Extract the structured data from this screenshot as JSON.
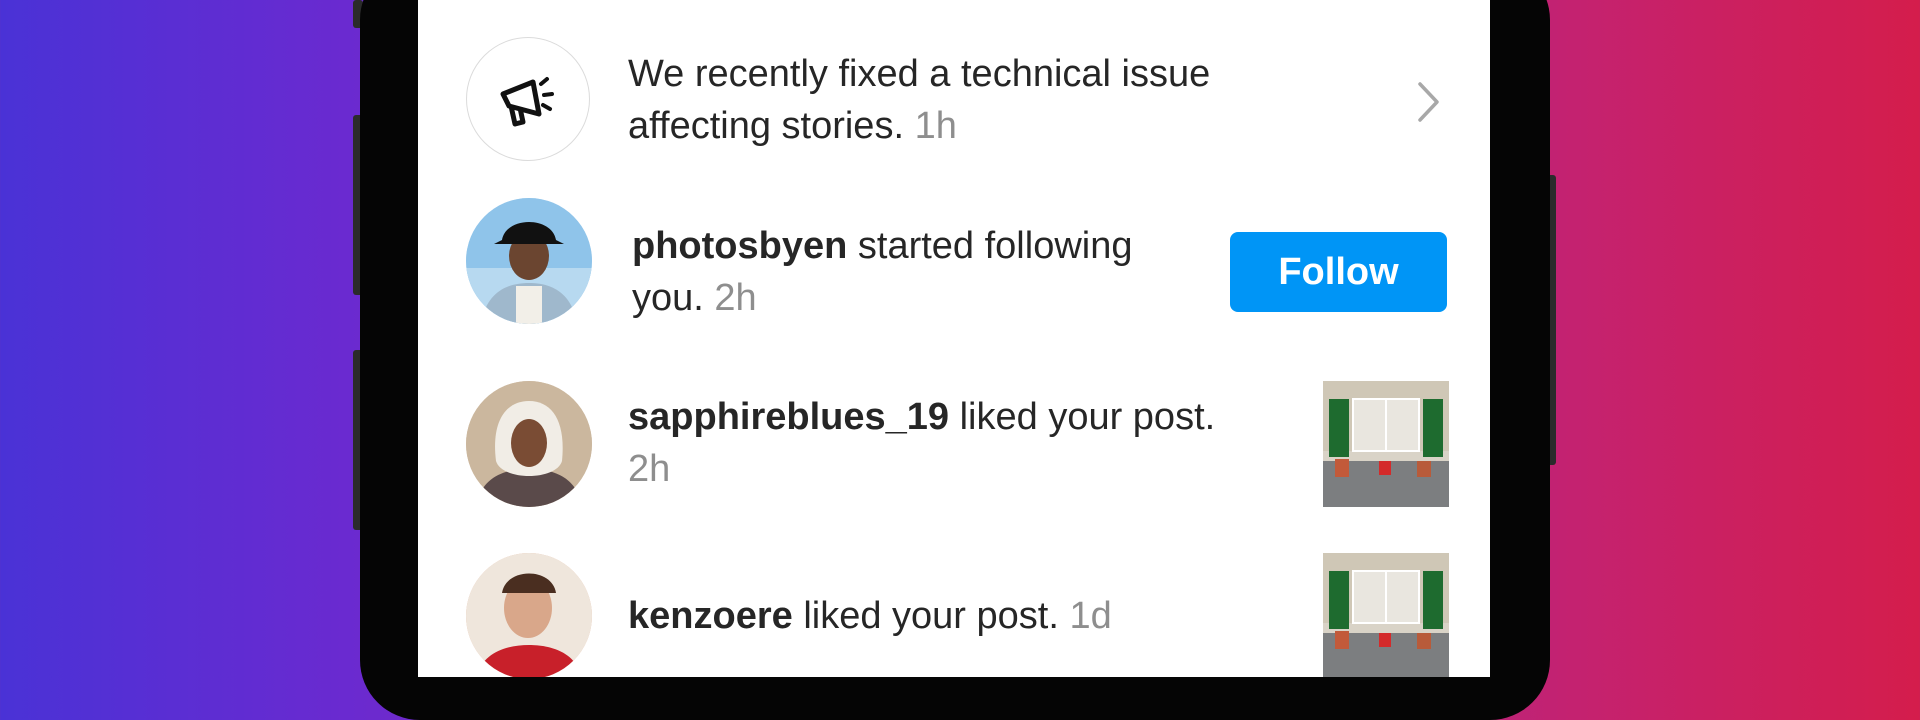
{
  "colors": {
    "accent": "#0095f6",
    "text_primary": "#262626",
    "text_secondary": "#8e8e8e",
    "divider": "#dbdbdb"
  },
  "notifications": [
    {
      "type": "announcement",
      "icon": "megaphone-icon",
      "line1": "We recently fixed a technical issue",
      "line2": "affecting stories.",
      "time": "1h",
      "trailing_icon": "chevron-right-icon"
    },
    {
      "type": "follow",
      "username": "photosbyen",
      "action_line1": "started following",
      "action_line2": "you.",
      "time": "2h",
      "button_label": "Follow"
    },
    {
      "type": "like",
      "username": "sapphireblues_19",
      "action": "liked your post.",
      "time": "2h"
    },
    {
      "type": "like",
      "username": "kenzoere",
      "action": "liked your post.",
      "time": "1d"
    }
  ]
}
